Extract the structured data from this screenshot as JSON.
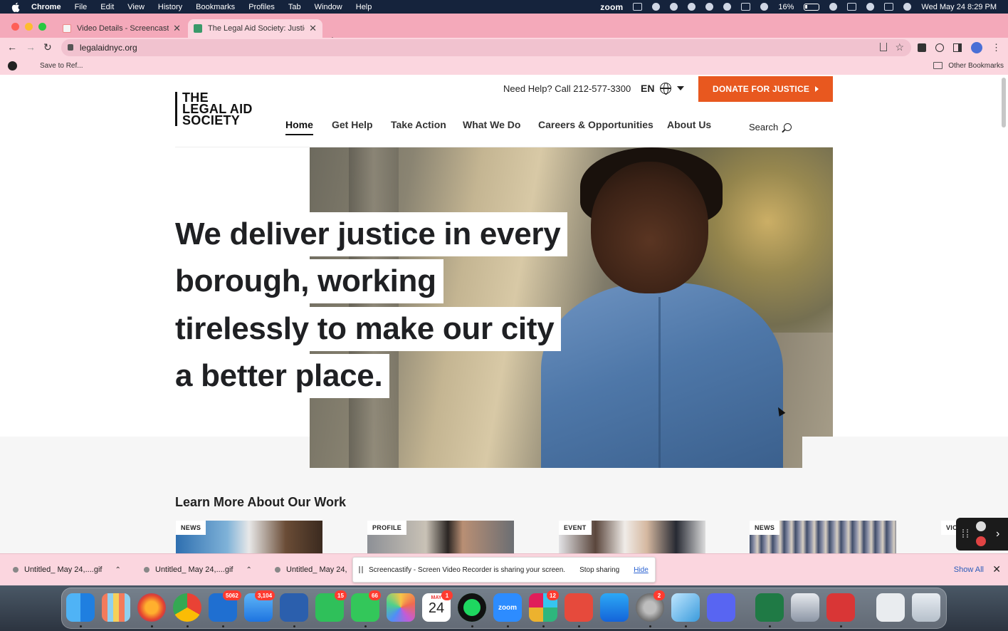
{
  "menubar": {
    "app": "Chrome",
    "items": [
      "File",
      "Edit",
      "View",
      "History",
      "Bookmarks",
      "Profiles",
      "Tab",
      "Window",
      "Help"
    ],
    "zoom_label": "zoom",
    "battery": "16%",
    "datetime": "Wed May 24  8:29 PM"
  },
  "browser": {
    "tabs": [
      {
        "title": "Video Details - Screencastify",
        "active": false
      },
      {
        "title": "The Legal Aid Society: Justice",
        "active": true
      }
    ],
    "url": "legalaidnyc.org",
    "bookmark_save": "Save to Ref...",
    "other_bookmarks": "Other Bookmarks"
  },
  "site": {
    "logo": [
      "THE",
      "LEGAL AID",
      "SOCIETY"
    ],
    "helpline": "Need Help? Call 212-577-3300",
    "language": "EN",
    "donate_label": "DONATE FOR JUSTICE",
    "nav": [
      "Home",
      "Get Help",
      "Take Action",
      "What We Do",
      "Careers & Opportunities",
      "About Us"
    ],
    "nav_active": "Home",
    "search_label": "Search",
    "headline_lines": [
      "We deliver justice in every",
      "borough, working",
      "tirelessly to make our city",
      "a better place."
    ],
    "section_title": "Learn More About Our Work",
    "cards": [
      {
        "tag": "NEWS"
      },
      {
        "tag": "PROFILE"
      },
      {
        "tag": "EVENT"
      },
      {
        "tag": "NEWS"
      },
      {
        "tag": "VIC"
      }
    ]
  },
  "downloads": {
    "items": [
      "Untitled_ May 24,....gif",
      "Untitled_ May 24,....gif",
      "Untitled_ May 24,"
    ],
    "share_message": "Screencastify - Screen Video Recorder is sharing your screen.",
    "stop_sharing": "Stop sharing",
    "hide": "Hide",
    "show_all": "Show All"
  },
  "dock": {
    "badges": {
      "outlook": "5062",
      "mail": "3,104",
      "facetime": "15",
      "messages": "66",
      "calendar": "1",
      "slack": "12",
      "settings": "2"
    },
    "calendar": {
      "month": "MAY",
      "day": "24"
    }
  },
  "colors": {
    "accent_donate": "#e8581f",
    "tabstrip": "#f4a9ba",
    "menubar": "#15233c"
  }
}
